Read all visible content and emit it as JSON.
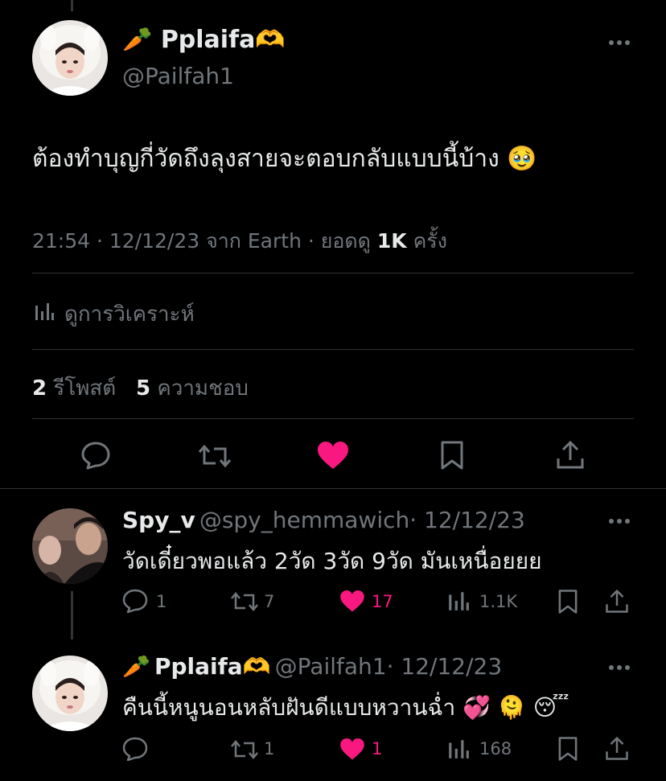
{
  "main_tweet": {
    "name": "Pplaifa",
    "name_prefix_emoji": "🥕",
    "name_suffix_emoji": "🫶",
    "handle": "@Pailfah1",
    "text": "ต้องทำบุญกี่วัดถึงลุงสายจะตอบกลับแบบนี้บ้าง",
    "text_emoji": "🥹",
    "time": "21:54 · 12/12/23 จาก Earth · ยอดดู ",
    "views": "1K",
    "views_suffix": " ครั้ง",
    "analytics_label": "ดูการวิเคราะห์",
    "retweets_count": "2",
    "retweets_label": "รีโพสต์",
    "likes_count": "5",
    "likes_label": "ความชอบ"
  },
  "replies": [
    {
      "name": "Spy_v",
      "handle": "@spy_hemmawich",
      "date": "· 12/12/23",
      "text": "วัดเดี๋ยวพอแล้ว 2วัด 3วัด 9วัด มันเหนื่อยยย",
      "replies": "1",
      "retweets": "7",
      "likes": "17",
      "views": "1.1K"
    },
    {
      "name": "Pplaifa",
      "name_prefix_emoji": "🥕",
      "name_suffix_emoji": "🫶",
      "handle": "@Pailfah1",
      "date": "· 12/12/23",
      "text": "คืนนี้หนูนอนหลับฝันดีแบบหวานฉ่ำ",
      "text_emoji": "💞 🫠 😴",
      "replies": "",
      "retweets": "1",
      "likes": "1",
      "views": "168"
    }
  ],
  "colors": {
    "background": "#000000",
    "text": "#e7e9ea",
    "secondary": "#71767b",
    "like": "#f91880",
    "divider": "#2f3336"
  }
}
